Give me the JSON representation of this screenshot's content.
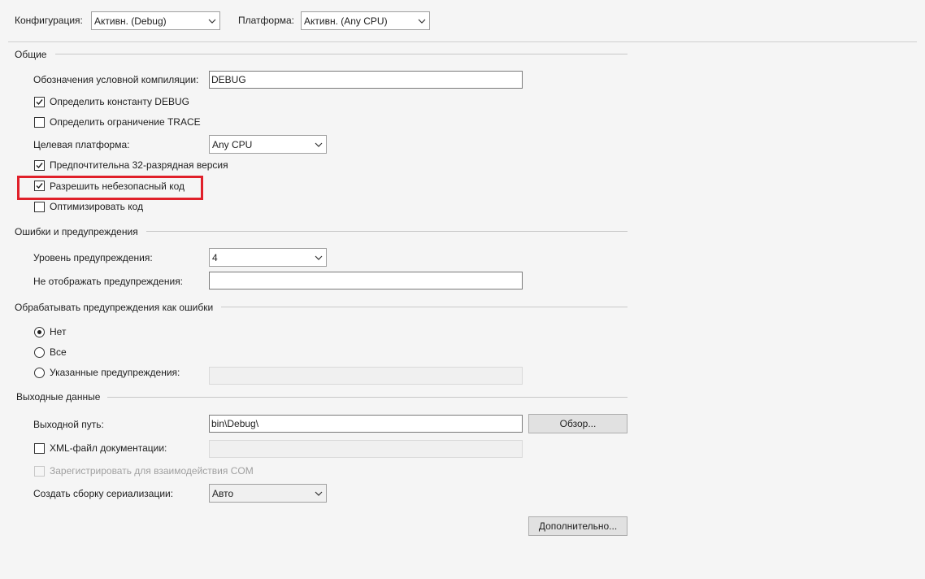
{
  "top": {
    "config_label": "Конфигурация:",
    "config_value": "Активн. (Debug)",
    "platform_label": "Платформа:",
    "platform_value": "Активн. (Any CPU)"
  },
  "general": {
    "header": "Общие",
    "cond_symbols_label": "Обозначения условной компиляции:",
    "cond_symbols_value": "DEBUG",
    "define_debug_label": "Определить константу DEBUG",
    "define_debug_checked": true,
    "define_trace_label": "Определить ограничение TRACE",
    "define_trace_checked": false,
    "target_platform_label": "Целевая платформа:",
    "target_platform_value": "Any CPU",
    "prefer32_label": "Предпочтительна 32-разрядная версия",
    "prefer32_checked": true,
    "allow_unsafe_label": "Разрешить небезопасный код",
    "allow_unsafe_checked": true,
    "optimize_label": "Оптимизировать код",
    "optimize_checked": false
  },
  "errors": {
    "header": "Ошибки и предупреждения",
    "warning_level_label": "Уровень предупреждения:",
    "warning_level_value": "4",
    "suppress_label": "Не отображать предупреждения:",
    "suppress_value": ""
  },
  "treat_warnings": {
    "header": "Обрабатывать предупреждения как ошибки",
    "none_label": "Нет",
    "all_label": "Все",
    "specific_label": "Указанные предупреждения:",
    "selected": "none",
    "specific_value": ""
  },
  "output": {
    "header": "Выходные данные",
    "path_label": "Выходной путь:",
    "path_value": "bin\\Debug\\",
    "browse_label": "Обзор...",
    "xml_doc_label": "XML-файл документации:",
    "xml_doc_checked": false,
    "xml_doc_value": "",
    "com_label": "Зарегистрировать для взаимодействия COM",
    "serialization_label": "Создать сборку сериализации:",
    "serialization_value": "Авто",
    "advanced_label": "Дополнительно..."
  },
  "colors": {
    "highlight": "#e0202a",
    "background": "#f5f5f5"
  }
}
